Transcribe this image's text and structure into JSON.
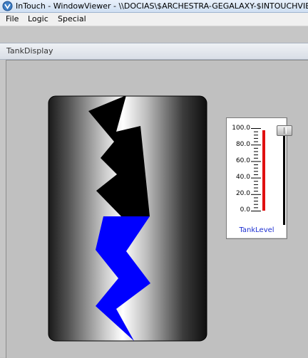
{
  "window": {
    "title": "InTouch - WindowViewer - \\\\DOCIAS\\$ARCHESTRA-GEGALAXY-$INTOUCHVIEWAPP"
  },
  "menu": {
    "items": [
      "File",
      "Logic",
      "Special"
    ]
  },
  "child_window": {
    "title": "TankDisplay"
  },
  "tank": {
    "fill_color": "#0000ff",
    "empty_color": "#000000",
    "level_fraction": 0.5
  },
  "slider": {
    "caption": "TankLevel",
    "scale_labels": [
      "100.0",
      "80.0",
      "60.0",
      "40.0",
      "20.0",
      "0.0"
    ],
    "scale_min": 0,
    "scale_max": 100,
    "value": 97,
    "bar_color": "#e01010",
    "caption_color": "#1c2fd1"
  },
  "icons": {
    "app": "intouch-app-icon",
    "thumb": "slider-thumb-grip"
  }
}
